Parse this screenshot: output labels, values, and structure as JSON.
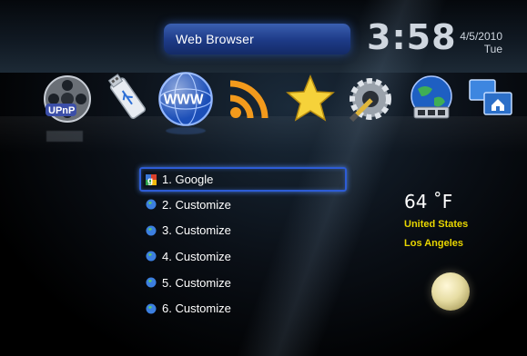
{
  "header": {
    "title": "Web Browser",
    "time": "3:58",
    "date": "4/5/2010",
    "weekday": "Tue"
  },
  "icons": [
    {
      "name": "upnp-icon",
      "label": "UPnP"
    },
    {
      "name": "usb-icon"
    },
    {
      "name": "www-icon",
      "label": "WWW",
      "selected": true
    },
    {
      "name": "rss-icon"
    },
    {
      "name": "favorites-star-icon"
    },
    {
      "name": "settings-gear-icon"
    },
    {
      "name": "network-globe-icon"
    },
    {
      "name": "home-network-icon"
    }
  ],
  "menu": {
    "items": [
      {
        "label": "1. Google",
        "selected": true
      },
      {
        "label": "2. Customize"
      },
      {
        "label": "3. Customize"
      },
      {
        "label": "4. Customize"
      },
      {
        "label": "5. Customize"
      },
      {
        "label": "6. Customize"
      }
    ]
  },
  "weather": {
    "temperature": "64 ˚F",
    "country": "United States",
    "city": "Los Angeles",
    "condition_icon": "moon-icon"
  },
  "colors": {
    "accent_blue": "#2d5cd6",
    "weather_text": "#e9d600"
  }
}
